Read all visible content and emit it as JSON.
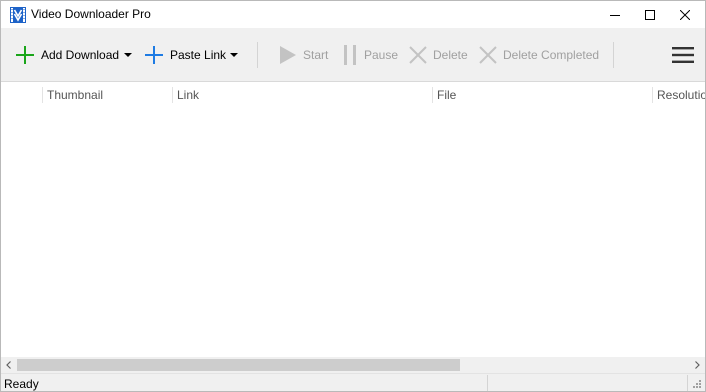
{
  "window": {
    "title": "Video Downloader Pro",
    "controls": {
      "minimize_icon": "minimize-icon",
      "maximize_icon": "maximize-icon",
      "close_icon": "close-icon"
    }
  },
  "toolbar": {
    "add_download": {
      "label": "Add Download",
      "icon": "plus-icon",
      "color": "#1aa51a"
    },
    "paste_link": {
      "label": "Paste Link",
      "icon": "plus-icon",
      "color": "#1e7be3"
    },
    "start": {
      "label": "Start",
      "icon": "play-icon",
      "enabled": false
    },
    "pause": {
      "label": "Pause",
      "icon": "pause-icon",
      "enabled": false
    },
    "delete": {
      "label": "Delete",
      "icon": "x-icon",
      "enabled": false
    },
    "delete_completed": {
      "label": "Delete Completed",
      "icon": "x-icon",
      "enabled": false
    },
    "menu_icon": "hamburger-menu-icon"
  },
  "list": {
    "columns": [
      "Thumbnail",
      "Link",
      "File",
      "Resolution"
    ],
    "rows": []
  },
  "status": {
    "text": "Ready"
  },
  "colors": {
    "toolbar_bg": "#f0f0f0",
    "disabled_text": "#a0a0a0",
    "add_green": "#1aa51a",
    "paste_blue": "#1e7be3",
    "app_icon_blue": "#1e63c8"
  }
}
